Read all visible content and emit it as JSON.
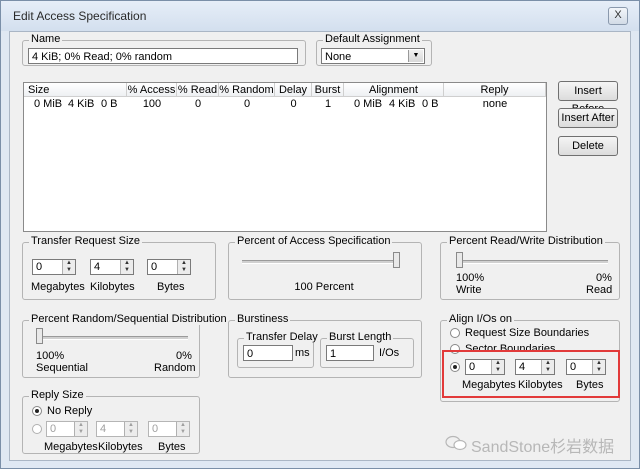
{
  "window": {
    "title": "Edit Access Specification",
    "close_glyph": "X"
  },
  "name": {
    "label": "Name",
    "value": "4 KiB; 0% Read; 0% random"
  },
  "default_assignment": {
    "label": "Default Assignment",
    "value": "None"
  },
  "list": {
    "headers": [
      "Size",
      "% Access",
      "% Read",
      "% Random",
      "Delay",
      "Burst",
      "Alignment",
      "Reply"
    ],
    "row": {
      "size_mb": "0 MiB",
      "size_kb": "4 KiB",
      "size_b": "0 B",
      "access": "100",
      "read": "0",
      "random": "0",
      "delay": "0",
      "burst": "1",
      "align_mb": "0 MiB",
      "align_kb": "4 KiB",
      "align_b": "0 B",
      "reply": "none"
    }
  },
  "buttons": {
    "insert_before": "Insert Before",
    "insert_after": "Insert After",
    "delete": "Delete"
  },
  "transfer": {
    "label": "Transfer Request Size",
    "mb": "0",
    "kb": "4",
    "b": "0",
    "mb_label": "Megabytes",
    "kb_label": "Kilobytes",
    "b_label": "Bytes"
  },
  "percent_access": {
    "label": "Percent of Access Specification",
    "value_text": "100 Percent",
    "value_fraction": 1.0
  },
  "read_write": {
    "label": "Percent Read/Write Distribution",
    "left_pct": "100%",
    "left_label": "Write",
    "right_pct": "0%",
    "right_label": "Read",
    "read_fraction": 0.0
  },
  "random_seq": {
    "label": "Percent Random/Sequential Distribution",
    "left_pct": "100%",
    "left_label": "Sequential",
    "right_pct": "0%",
    "right_label": "Random",
    "random_fraction": 0.0
  },
  "burstiness": {
    "label": "Burstiness",
    "delay_label": "Transfer Delay",
    "delay_value": "0",
    "delay_unit": "ms",
    "burst_label": "Burst Length",
    "burst_value": "1",
    "burst_unit": "I/Os"
  },
  "align": {
    "label": "Align I/Os on",
    "opt1": "Request Size Boundaries",
    "opt2": "Sector Boundaries",
    "mb": "0",
    "kb": "4",
    "b": "0",
    "mb_label": "Megabytes",
    "kb_label": "Kilobytes",
    "b_label": "Bytes"
  },
  "reply": {
    "label": "Reply Size",
    "no_reply": "No Reply",
    "mb": "0",
    "kb": "4",
    "b": "0",
    "mb_label": "Megabytes",
    "kb_label": "Kilobytes",
    "b_label": "Bytes"
  },
  "watermark": {
    "text": "SandStone杉岩数据"
  },
  "colors": {
    "highlight": "#e23a3a",
    "background": "#f0f0f0"
  }
}
